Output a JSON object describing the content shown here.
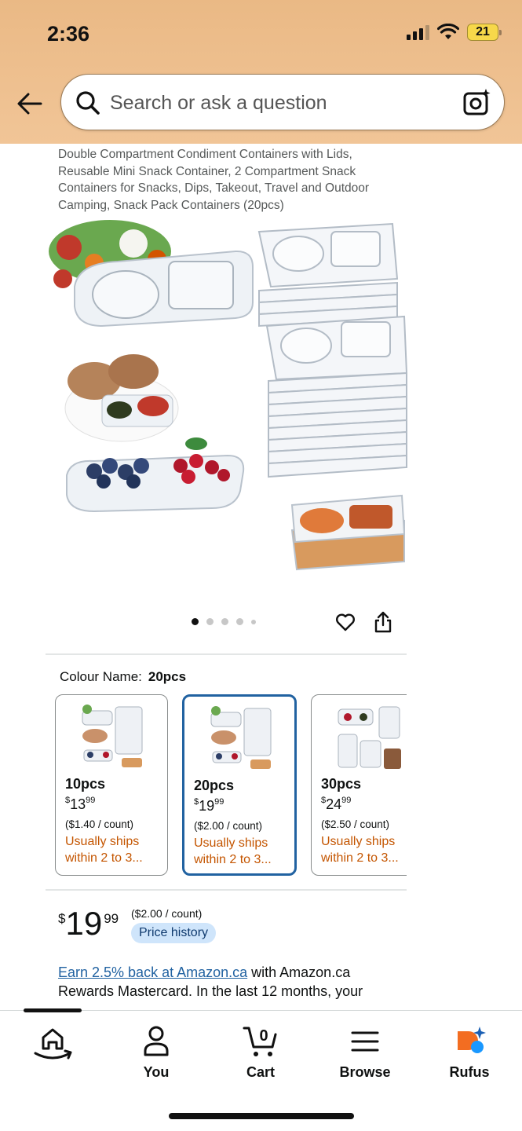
{
  "status_bar": {
    "time": "2:36",
    "battery": "21"
  },
  "search": {
    "placeholder": "Search or ask a question"
  },
  "product": {
    "title": "Double Compartment Condiment Containers with Lids, Reusable Mini Snack Container, 2 Compartment Snack Containers for Snacks, Dips, Takeout, Travel and Outdoor Camping, Snack Pack Containers (20pcs)",
    "image_count": 5,
    "active_image_index": 0
  },
  "colour": {
    "label": "Colour Name:",
    "selected": "20pcs",
    "options": [
      {
        "name": "10pcs",
        "currency": "$",
        "whole": "13",
        "fraction": "99",
        "unit": "($1.40 / count)",
        "ship_line1": "Usually ships",
        "ship_line2": "within 2 to 3...",
        "selected": false
      },
      {
        "name": "20pcs",
        "currency": "$",
        "whole": "19",
        "fraction": "99",
        "unit": "($2.00 / count)",
        "ship_line1": "Usually ships",
        "ship_line2": "within 2 to 3...",
        "selected": true
      },
      {
        "name": "30pcs",
        "currency": "$",
        "whole": "24",
        "fraction": "99",
        "unit": "($2.50 / count)",
        "ship_line1": "Usually ships",
        "ship_line2": "within 2 to 3...",
        "selected": false
      }
    ]
  },
  "price": {
    "currency": "$",
    "whole": "19",
    "fraction": "99",
    "unit": "($2.00 / count)",
    "history_label": "Price history"
  },
  "rewards": {
    "link": "Earn 2.5% back at Amazon.ca",
    "text": " with Amazon.ca Rewards Mastercard. In the last 12 months, your"
  },
  "nav": {
    "home": "",
    "you": "You",
    "cart": "Cart",
    "cart_count": "0",
    "browse": "Browse",
    "rufus": "Rufus"
  },
  "colors": {
    "header": "#eab985",
    "link": "#2162a1",
    "shipping": "#c45500",
    "selected_border": "#2162a1"
  }
}
